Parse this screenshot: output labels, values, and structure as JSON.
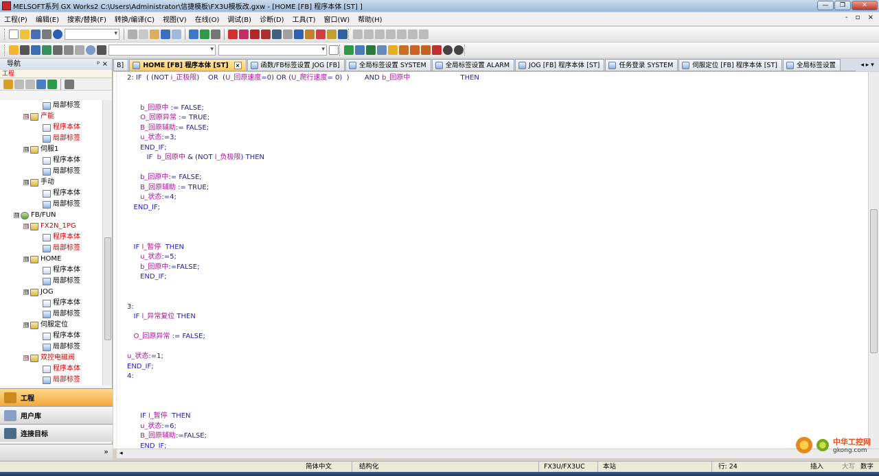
{
  "window": {
    "title": "MELSOFT系列 GX Works2 C:\\Users\\Administrator\\信捷模板\\FX3U模板改.gxw - [HOME [FB] 程序本体 [ST] ]",
    "controls": [
      "—",
      "❐",
      "✕"
    ]
  },
  "menu": {
    "items": [
      "工程(P)",
      "编辑(E)",
      "搜索/替换(F)",
      "转换/编译(C)",
      "视图(V)",
      "在线(O)",
      "调试(B)",
      "诊断(D)",
      "工具(T)",
      "窗口(W)",
      "帮助(H)"
    ],
    "right_controls": "- ▫ ×"
  },
  "navigation": {
    "title": "导航",
    "pin": "ᵖ ×",
    "section": "工程",
    "tree": [
      {
        "text": "局部标签",
        "level": 3,
        "icon": "label-icon",
        "red": false,
        "expand": ""
      },
      {
        "text": "产能",
        "level": 2,
        "icon": "program-folder-icon",
        "red": true,
        "expand": "⊟"
      },
      {
        "text": "程序本体",
        "level": 3,
        "icon": "program-icon",
        "red": true,
        "expand": ""
      },
      {
        "text": "局部标签",
        "level": 3,
        "icon": "label-icon",
        "red": true,
        "expand": ""
      },
      {
        "text": "伺服1",
        "level": 2,
        "icon": "program-folder-icon",
        "red": false,
        "expand": "⊟"
      },
      {
        "text": "程序本体",
        "level": 3,
        "icon": "program-icon",
        "red": false,
        "expand": ""
      },
      {
        "text": "局部标签",
        "level": 3,
        "icon": "label-icon",
        "red": false,
        "expand": ""
      },
      {
        "text": "手动",
        "level": 2,
        "icon": "program-folder-icon",
        "red": false,
        "expand": "⊟"
      },
      {
        "text": "程序本体",
        "level": 3,
        "icon": "program-icon",
        "red": false,
        "expand": ""
      },
      {
        "text": "局部标签",
        "level": 3,
        "icon": "label-icon",
        "red": false,
        "expand": ""
      },
      {
        "text": "FB/FUN",
        "level": 1,
        "icon": "fbfun-icon",
        "red": false,
        "expand": "⊟"
      },
      {
        "text": "FX2N_1PG",
        "level": 2,
        "icon": "folder-icon",
        "red": true,
        "expand": "⊟"
      },
      {
        "text": "程序本体",
        "level": 3,
        "icon": "program-icon",
        "red": true,
        "expand": ""
      },
      {
        "text": "局部标签",
        "level": 3,
        "icon": "label-icon",
        "red": true,
        "expand": ""
      },
      {
        "text": "HOME",
        "level": 2,
        "icon": "folder-icon",
        "red": false,
        "expand": "⊟"
      },
      {
        "text": "程序本体",
        "level": 3,
        "icon": "program-icon",
        "red": false,
        "expand": ""
      },
      {
        "text": "局部标签",
        "level": 3,
        "icon": "label-icon",
        "red": false,
        "expand": ""
      },
      {
        "text": "JOG",
        "level": 2,
        "icon": "folder-icon",
        "red": false,
        "expand": "⊟"
      },
      {
        "text": "程序本体",
        "level": 3,
        "icon": "program-icon",
        "red": false,
        "expand": ""
      },
      {
        "text": "局部标签",
        "level": 3,
        "icon": "label-icon",
        "red": false,
        "expand": ""
      },
      {
        "text": "伺服定位",
        "level": 2,
        "icon": "folder-icon",
        "red": false,
        "expand": "⊟"
      },
      {
        "text": "程序本体",
        "level": 3,
        "icon": "program-icon",
        "red": false,
        "expand": ""
      },
      {
        "text": "局部标签",
        "level": 3,
        "icon": "label-icon",
        "red": false,
        "expand": ""
      },
      {
        "text": "双控电磁阀",
        "level": 2,
        "icon": "folder-icon",
        "red": true,
        "expand": "⊟"
      },
      {
        "text": "程序本体",
        "level": 3,
        "icon": "program-icon",
        "red": true,
        "expand": ""
      },
      {
        "text": "局部标签",
        "level": 3,
        "icon": "label-icon",
        "red": true,
        "expand": ""
      }
    ],
    "buttons": [
      "工程",
      "用户库",
      "连接目标"
    ],
    "footer": "»"
  },
  "tabs": {
    "items": [
      {
        "label": "B]",
        "active": false,
        "closable": false,
        "icon": false
      },
      {
        "label": "HOME [FB] 程序本体 [ST]",
        "active": true,
        "closable": true,
        "icon": true
      },
      {
        "label": "函数/FB标签设置 JOG [FB]",
        "active": false,
        "closable": false,
        "icon": true
      },
      {
        "label": "全局标签设置 SYSTEM",
        "active": false,
        "closable": false,
        "icon": true
      },
      {
        "label": "全局标签设置 ALARM",
        "active": false,
        "closable": false,
        "icon": true
      },
      {
        "label": "JOG [FB] 程序本体 [ST]",
        "active": false,
        "closable": false,
        "icon": true
      },
      {
        "label": "任务登录 SYSTEM",
        "active": false,
        "closable": false,
        "icon": true
      },
      {
        "label": "伺服定位 [FB] 程序本体 [ST]",
        "active": false,
        "closable": false,
        "icon": true
      },
      {
        "label": "全局标签设置",
        "active": false,
        "closable": false,
        "icon": true
      }
    ],
    "arrows": "◂ ▸ ▾"
  },
  "code": {
    "lines": [
      [
        {
          "t": "2: ",
          "c": "lb"
        },
        {
          "t": "IF",
          "c": "kw"
        },
        {
          "t": "  ( (NOT ",
          "c": "lb"
        },
        {
          "t": "i_正极限",
          "c": "vr"
        },
        {
          "t": ")    OR  (",
          "c": "lb"
        },
        {
          "t": "U_回原速度",
          "c": "vr"
        },
        {
          "t": "=0) OR (",
          "c": "lb"
        },
        {
          "t": "U_爬行速度",
          "c": "vr"
        },
        {
          "t": "= 0)  )       AND ",
          "c": "lb"
        },
        {
          "t": "b_回原中",
          "c": "vr"
        },
        {
          "t": "                       THEN",
          "c": "kw"
        }
      ],
      [],
      [],
      [
        {
          "t": "      "
        },
        {
          "t": "b_回原中",
          "c": "vr"
        },
        {
          "t": " := FALSE;",
          "c": "lb"
        }
      ],
      [
        {
          "t": "      "
        },
        {
          "t": "O_回原异常",
          "c": "vr"
        },
        {
          "t": " := TRUE;",
          "c": "lb"
        }
      ],
      [
        {
          "t": "      "
        },
        {
          "t": "B_回原辅助",
          "c": "vr"
        },
        {
          "t": ":= FALSE;",
          "c": "lb"
        }
      ],
      [
        {
          "t": "      "
        },
        {
          "t": "u_状态",
          "c": "vr"
        },
        {
          "t": ":=3;",
          "c": "lb"
        }
      ],
      [
        {
          "t": "      "
        },
        {
          "t": "END_IF;",
          "c": "kw"
        }
      ],
      [
        {
          "t": "         "
        },
        {
          "t": "IF ",
          "c": "kw"
        },
        {
          "t": " b_回原中",
          "c": "vr"
        },
        {
          "t": " & (NOT ",
          "c": "lb"
        },
        {
          "t": "l_负极限",
          "c": "vr"
        },
        {
          "t": ") ",
          "c": "lb"
        },
        {
          "t": "THEN",
          "c": "kw"
        }
      ],
      [],
      [
        {
          "t": "      "
        },
        {
          "t": "b_回原中",
          "c": "vr"
        },
        {
          "t": ":= FALSE;",
          "c": "lb"
        }
      ],
      [
        {
          "t": "      "
        },
        {
          "t": "B_回原辅助",
          "c": "vr"
        },
        {
          "t": " := TRUE;",
          "c": "lb"
        }
      ],
      [
        {
          "t": "      "
        },
        {
          "t": "u_状态",
          "c": "vr"
        },
        {
          "t": ":=4;",
          "c": "lb"
        }
      ],
      [
        {
          "t": "   "
        },
        {
          "t": "END_IF;",
          "c": "kw"
        }
      ],
      [],
      [],
      [],
      [
        {
          "t": "   "
        },
        {
          "t": "IF ",
          "c": "kw"
        },
        {
          "t": "l_暂停",
          "c": "vr"
        },
        {
          "t": "  THEN",
          "c": "kw"
        }
      ],
      [
        {
          "t": "      "
        },
        {
          "t": "u_状态",
          "c": "vr"
        },
        {
          "t": ":=5;",
          "c": "lb"
        }
      ],
      [
        {
          "t": "      "
        },
        {
          "t": "b_回原中",
          "c": "vr"
        },
        {
          "t": ":=FALSE;",
          "c": "lb"
        }
      ],
      [
        {
          "t": "      "
        },
        {
          "t": "END_IF;",
          "c": "kw"
        }
      ],
      [],
      [],
      [
        {
          "t": "3:",
          "c": "lb"
        }
      ],
      [
        {
          "t": "   "
        },
        {
          "t": "IF ",
          "c": "kw"
        },
        {
          "t": "l_异常复位",
          "c": "vr"
        },
        {
          "t": " THEN",
          "c": "kw"
        }
      ],
      [],
      [
        {
          "t": "   "
        },
        {
          "t": "O_回原异常",
          "c": "vr"
        },
        {
          "t": " := FALSE;",
          "c": "lb"
        }
      ],
      [],
      [
        {
          "t": "u_状态",
          "c": "vr"
        },
        {
          "t": ":=1;",
          "c": "lb"
        }
      ],
      [
        {
          "t": "END_IF;",
          "c": "kw"
        }
      ],
      [
        {
          "t": "4:",
          "c": "lb"
        }
      ],
      [],
      [],
      [],
      [
        {
          "t": "      "
        },
        {
          "t": "IF ",
          "c": "kw"
        },
        {
          "t": "l_暂停",
          "c": "vr"
        },
        {
          "t": "  THEN",
          "c": "kw"
        }
      ],
      [
        {
          "t": "      "
        },
        {
          "t": "u_状态",
          "c": "vr"
        },
        {
          "t": ":=6;",
          "c": "lb"
        }
      ],
      [
        {
          "t": "      "
        },
        {
          "t": "B_回原辅助",
          "c": "vr"
        },
        {
          "t": ":=FALSE;",
          "c": "lb"
        }
      ],
      [
        {
          "t": "      "
        },
        {
          "t": "END_IF;",
          "c": "kw"
        }
      ]
    ]
  },
  "statusbar": {
    "language": "简体中文",
    "mode": "结构化",
    "plc": "FX3U/FX3UC",
    "station": "本站",
    "row": "行: 24",
    "insert": "插入",
    "caps": "大写",
    "num": "数字"
  },
  "watermark": {
    "text": "中华工控网",
    "url": "gkong.com"
  }
}
